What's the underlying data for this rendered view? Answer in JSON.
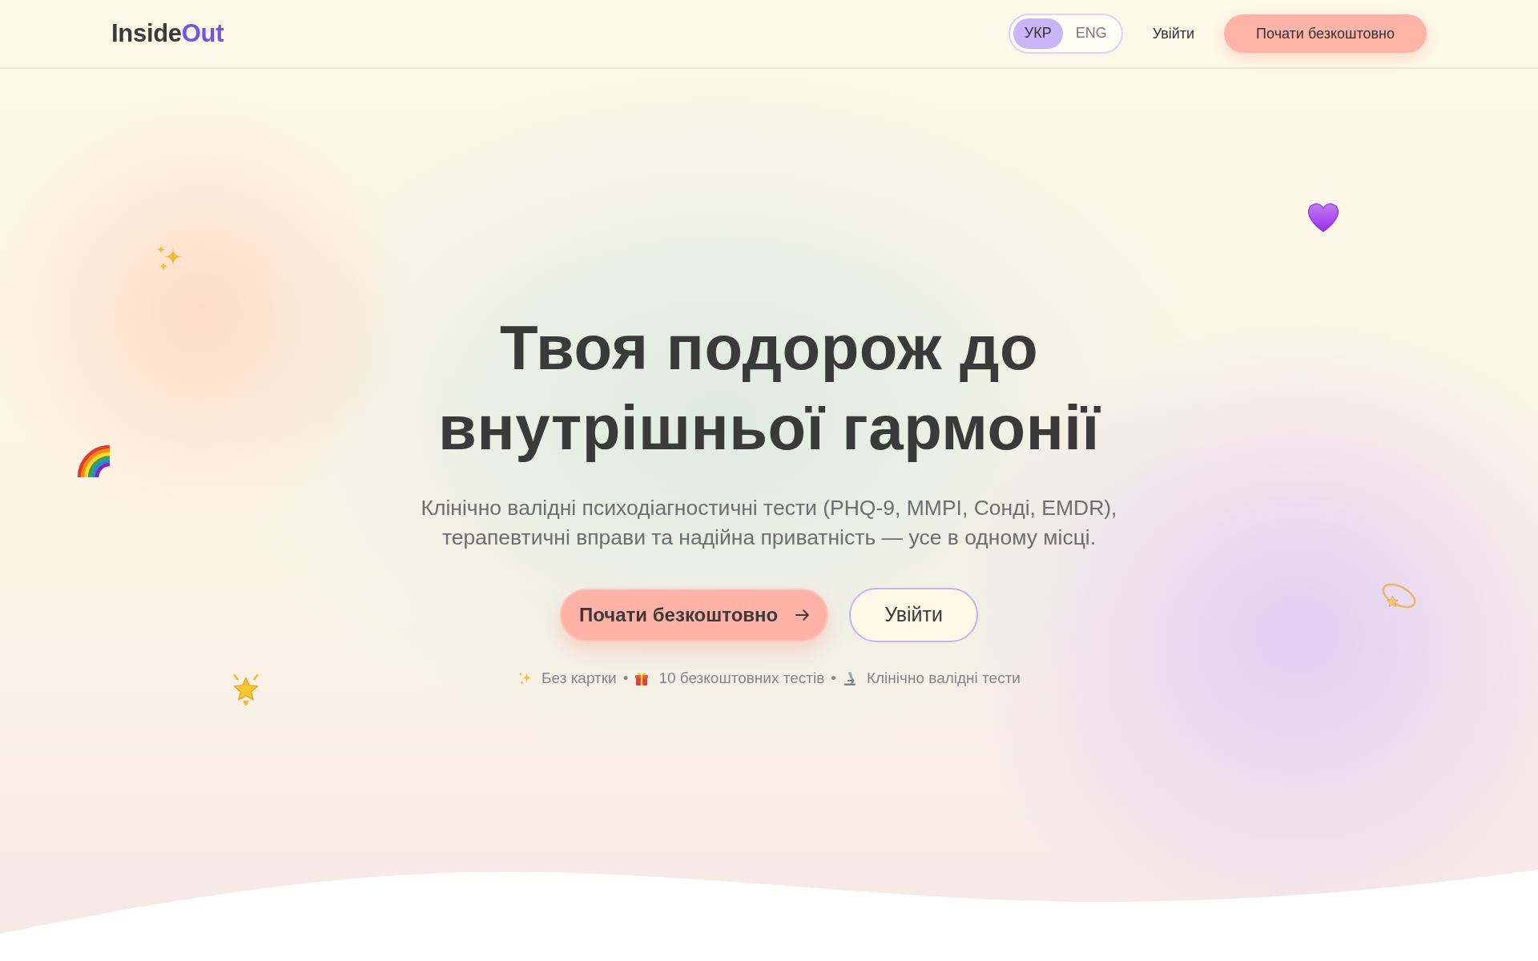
{
  "navbar": {
    "logo": {
      "text": "Inside",
      "accent": "Out"
    },
    "languages": [
      {
        "label": "УКР",
        "selected": true
      },
      {
        "label": "ENG",
        "selected": false
      }
    ],
    "login_link": "Увійти",
    "cta_button": "Почати безкоштовно"
  },
  "hero": {
    "title": "Твоя подорож до внутрішньої гармонії",
    "subtitle": "Клінічно валідні психодіагностичні тести (PHQ-9, MMPI, Сонді, EMDR), терапевтичні вправи та надійна приватність — усе в одному місці.",
    "primary_button": "Почати безкоштовно",
    "secondary_button": "Увійти",
    "perks": [
      {
        "kind": "sparkles",
        "text": "Без картки"
      },
      {
        "kind": "gift",
        "text": "10 безкоштовних тестів"
      },
      {
        "kind": "microscope",
        "text": "Клінічно валідні тести"
      }
    ],
    "separators": [
      "•",
      "•"
    ]
  }
}
